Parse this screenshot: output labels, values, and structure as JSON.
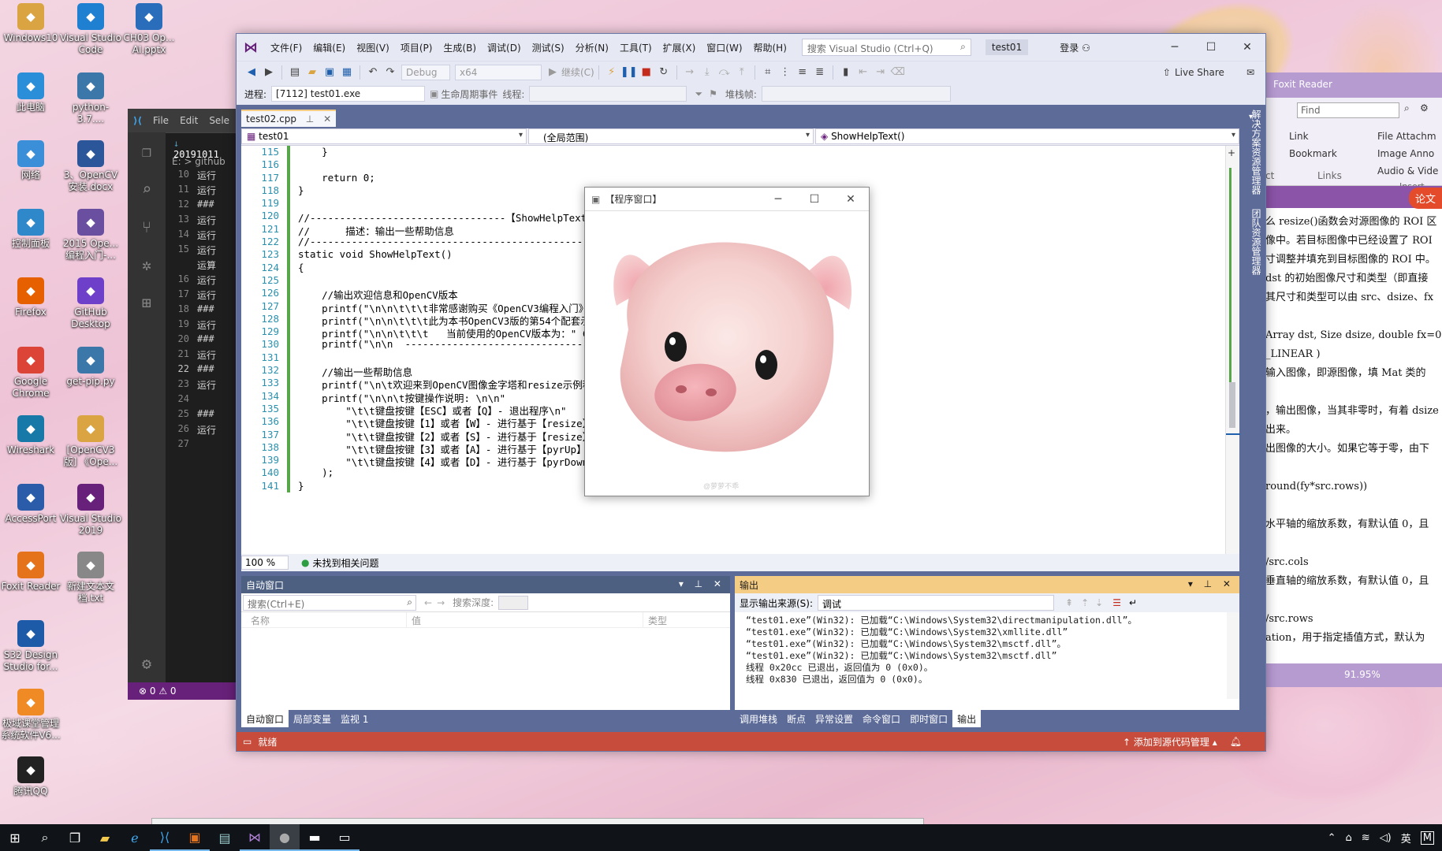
{
  "desktop": {
    "icons": [
      {
        "label": "Windows10",
        "icon": "user-folder-icon",
        "color": "#d9a441"
      },
      {
        "label": "Visual Studio Code",
        "icon": "vscode-icon",
        "color": "#1f7fd0"
      },
      {
        "label": "CH03 Op... AI.pptx",
        "icon": "pptx-file-icon",
        "color": "#2a6ebb"
      },
      {
        "label": "此电脑",
        "icon": "computer-icon",
        "color": "#2a8fd8"
      },
      {
        "label": "python-3.7....",
        "icon": "python-installer-icon",
        "color": "#3b77a8"
      },
      {
        "label": "网络",
        "icon": "network-icon",
        "color": "#3a8fd8"
      },
      {
        "label": "3、OpenCV 安装.docx",
        "icon": "docx-file-icon",
        "color": "#2b579a"
      },
      {
        "label": "控制面板",
        "icon": "control-panel-icon",
        "color": "#2f88c9"
      },
      {
        "label": "2015 Ope... 编程入门-...",
        "icon": "book-icon",
        "color": "#6a4fa0"
      },
      {
        "label": "Firefox",
        "icon": "firefox-icon",
        "color": "#e66000"
      },
      {
        "label": "GitHub Desktop",
        "icon": "github-desktop-icon",
        "color": "#6e40c9"
      },
      {
        "label": "Google Chrome",
        "icon": "chrome-icon",
        "color": "#db4437"
      },
      {
        "label": "get-pip.py",
        "icon": "python-file-icon",
        "color": "#3b77a8"
      },
      {
        "label": "Wireshark",
        "icon": "wireshark-icon",
        "color": "#1679a7"
      },
      {
        "label": "[OpenCV3 版] 《Ope...",
        "icon": "text-file-icon",
        "color": "#d9a441"
      },
      {
        "label": "AccessPort",
        "icon": "accessport-icon",
        "color": "#2a5caa"
      },
      {
        "label": "Visual Studio 2019",
        "icon": "visual-studio-icon",
        "color": "#68217a"
      },
      {
        "label": "Foxit Reader",
        "icon": "foxit-reader-icon",
        "color": "#e5731c"
      },
      {
        "label": "新建文本文 档.txt",
        "icon": "txt-file-icon",
        "color": "#888888"
      },
      {
        "label": "S32 Design Studio for...",
        "icon": "s32-studio-icon",
        "color": "#1d5aa7"
      },
      {
        "label": "极域课堂管理 系统软件V6...",
        "icon": "classroom-icon",
        "color": "#f08a24"
      },
      {
        "label": "腾讯QQ",
        "icon": "qq-icon",
        "color": "#222222"
      }
    ]
  },
  "vscode": {
    "menu": [
      "File",
      "Edit",
      "Sele"
    ],
    "tab": "20191011",
    "path": "E: > github",
    "lines": [
      {
        "n": "10",
        "t": "运行"
      },
      {
        "n": "11",
        "t": "运行"
      },
      {
        "n": "12",
        "t": "###"
      },
      {
        "n": "13",
        "t": "运行"
      },
      {
        "n": "14",
        "t": "运行"
      },
      {
        "n": "15",
        "t": "运行"
      },
      {
        "n": "",
        "t": "运算"
      },
      {
        "n": "16",
        "t": "运行"
      },
      {
        "n": "17",
        "t": "运行"
      },
      {
        "n": "18",
        "t": "###"
      },
      {
        "n": "19",
        "t": "运行"
      },
      {
        "n": "20",
        "t": "###"
      },
      {
        "n": "21",
        "t": "运行"
      },
      {
        "n": "22",
        "t": "###"
      },
      {
        "n": "23",
        "t": "运行"
      },
      {
        "n": "24",
        "t": ""
      },
      {
        "n": "25",
        "t": "###"
      },
      {
        "n": "26",
        "t": "运行"
      },
      {
        "n": "27",
        "t": ""
      }
    ],
    "status": "⊗ 0 ⚠ 0"
  },
  "foxit": {
    "title": "Foxit Reader",
    "find_placeholder": "Find",
    "ribbon": {
      "link": "Link",
      "bookmark": "Bookmark",
      "links_group": "Links",
      "file_attach": "File Attachm",
      "image_anno": "Image Anno",
      "audio_video": "Audio & Vide",
      "insert_group": "Insert",
      "ct": "ct"
    },
    "badge": "论文",
    "doc_lines": [
      "么 resize()函数会对源图像的 ROI 区",
      "像中。若目标图像中已经设置了 ROI",
      "寸调整并填充到目标图像的 ROI 中。",
      "dst 的初始图像尺寸和类型（即直接",
      "其尺寸和类型可以由 src、dsize、fx",
      "",
      "Array dst, Size dsize, double fx=0,",
      "_LINEAR )",
      "输入图像，即源图像，填 Mat 类的",
      "",
      "，输出图像，当其非零时，有着 dsize",
      "出来。",
      "出图像的大小。如果它等于零，由下",
      "",
      "round(fy*src.rows))",
      "",
      "水平轴的缩放系数，有默认值 0，且",
      "",
      "/src.cols",
      "垂直轴的缩放系数，有默认值 0，且",
      "",
      "/src.rows",
      "ation，用于指定插值方式，默认为"
    ],
    "zoom": "91.95%"
  },
  "vs": {
    "menu": [
      "文件(F)",
      "编辑(E)",
      "视图(V)",
      "项目(P)",
      "生成(B)",
      "调试(D)",
      "测试(S)",
      "分析(N)",
      "工具(T)",
      "扩展(X)",
      "窗口(W)",
      "帮助(H)"
    ],
    "search_placeholder": "搜索 Visual Studio (Ctrl+Q)",
    "solution_title": "test01",
    "login": "登录",
    "config": "Debug",
    "platform": "x64",
    "continue": "继续(C)",
    "live_share": "Live Share",
    "process_label": "进程:",
    "process": "[7112] test01.exe",
    "lifecycle": "生命周期事件",
    "thread_label": "线程:",
    "stackframe_label": "堆栈帧:",
    "doc_tab": "test02.cpp",
    "nav_project": "test01",
    "nav_scope": "(全局范围)",
    "nav_member": "ShowHelpText()",
    "side_labels": [
      "解决方案资源管理器",
      "团队资源管理器"
    ],
    "code": [
      {
        "n": "115",
        "t": "    }"
      },
      {
        "n": "116",
        "t": ""
      },
      {
        "n": "117",
        "t": "    return 0;"
      },
      {
        "n": "118",
        "t": "}"
      },
      {
        "n": "119",
        "t": ""
      },
      {
        "n": "120",
        "t": "//---------------------------------【ShowHelpText( )函数】-----"
      },
      {
        "n": "121",
        "t": "//      描述：输出一些帮助信息"
      },
      {
        "n": "122",
        "t": "//-----------------------------------------------------------"
      },
      {
        "n": "123",
        "t": "static void ShowHelpText()"
      },
      {
        "n": "124",
        "t": "{"
      },
      {
        "n": "125",
        "t": ""
      },
      {
        "n": "126",
        "t": "    //输出欢迎信息和OpenCV版本"
      },
      {
        "n": "127",
        "t": "    printf(\"\\n\\n\\t\\t\\t非常感谢购买《OpenCV3编程入门》一书！\\n\");"
      },
      {
        "n": "128",
        "t": "    printf(\"\\n\\n\\t\\t\\t此为本书OpenCV3版的第54个配套示例程序\\n\");"
      },
      {
        "n": "129",
        "t": "    printf(\"\\n\\n\\t\\t\\t   当前使用的OpenCV版本为：\" CV_VERSION );"
      },
      {
        "n": "130",
        "t": "    printf(\"\\n\\n  ----------------------------------------\\n\");"
      },
      {
        "n": "131",
        "t": ""
      },
      {
        "n": "132",
        "t": "    //输出一些帮助信息"
      },
      {
        "n": "133",
        "t": "    printf(\"\\n\\t欢迎来到OpenCV图像金字塔和resize示例程序~\\n\\n\");"
      },
      {
        "n": "134",
        "t": "    printf(\"\\n\\n\\t按键操作说明: \\n\\n\""
      },
      {
        "n": "135",
        "t": "        \"\\t\\t键盘按键【ESC】或者【Q】- 退出程序\\n\""
      },
      {
        "n": "136",
        "t": "        \"\\t\\t键盘按键【1】或者【W】- 进行基于【resize】函数的图片放大\\n\""
      },
      {
        "n": "137",
        "t": "        \"\\t\\t键盘按键【2】或者【S】- 进行基于【resize】函数的图片缩小\\n\""
      },
      {
        "n": "138",
        "t": "        \"\\t\\t键盘按键【3】或者【A】- 进行基于【pyrUp】函数的图片放大\\n\""
      },
      {
        "n": "139",
        "t": "        \"\\t\\t键盘按键【4】或者【D】- 进行基于【pyrDown】函数的图片缩小\\n\""
      },
      {
        "n": "140",
        "t": "    );"
      },
      {
        "n": "141",
        "t": "}"
      }
    ],
    "zoom": "100 %",
    "issues": "未找到相关问题",
    "autos": {
      "title": "自动窗口",
      "search_placeholder": "搜索(Ctrl+E)",
      "depth_label": "搜索深度:",
      "col_name": "名称",
      "col_value": "值",
      "col_type": "类型",
      "tabs": [
        "自动窗口",
        "局部变量",
        "监视 1"
      ]
    },
    "output": {
      "title": "输出",
      "source_label": "显示输出来源(S):",
      "source": "调试",
      "lines": [
        "“test01.exe”(Win32): 已加载“C:\\Windows\\System32\\directmanipulation.dll”。",
        "“test01.exe”(Win32): 已加载“C:\\Windows\\System32\\xmllite.dll”",
        "“test01.exe”(Win32): 已加载“C:\\Windows\\System32\\msctf.dll”。",
        "“test01.exe”(Win32): 已加载“C:\\Windows\\System32\\msctf.dll”",
        "线程 0x20cc 已退出，返回值为 0 (0x0)。",
        "线程 0x830 已退出，返回值为 0 (0x0)。"
      ],
      "tabs": [
        "调用堆栈",
        "断点",
        "异常设置",
        "命令窗口",
        "即时窗口",
        "输出"
      ]
    },
    "status": "就绪",
    "source_control": "添加到源代码管理"
  },
  "program_window": {
    "title": "【程序窗口】",
    "watermark": "@萝萝不乖"
  },
  "taskbar": {
    "tray_ime": "英",
    "tray_m": "M"
  }
}
